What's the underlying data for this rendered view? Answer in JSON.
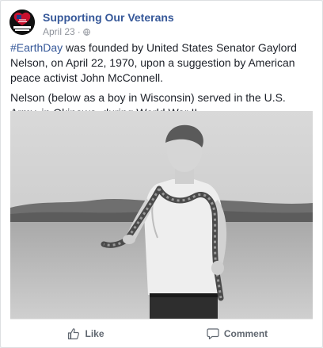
{
  "post": {
    "page_name": "Supporting Our Veterans",
    "date": "April 23",
    "separator": "·",
    "privacy_icon": "globe-icon",
    "hashtag": "#EarthDay",
    "paragraph1_rest": " was founded by United States Senator Gaylord Nelson, on April 22, 1970, upon a suggestion by American peace activist John McConnell.",
    "paragraph2": "Nelson (below as a boy in Wisconsin) served in the U.S. Army, in Okinawa, during World War II.",
    "avatar_text": "Support Our Veterans"
  },
  "actions": {
    "like_label": "Like",
    "comment_label": "Comment",
    "like_icon": "thumbs-up-icon",
    "comment_icon": "comment-bubble-icon"
  },
  "colors": {
    "link": "#365899",
    "text": "#1d2129",
    "meta": "#90949c"
  }
}
